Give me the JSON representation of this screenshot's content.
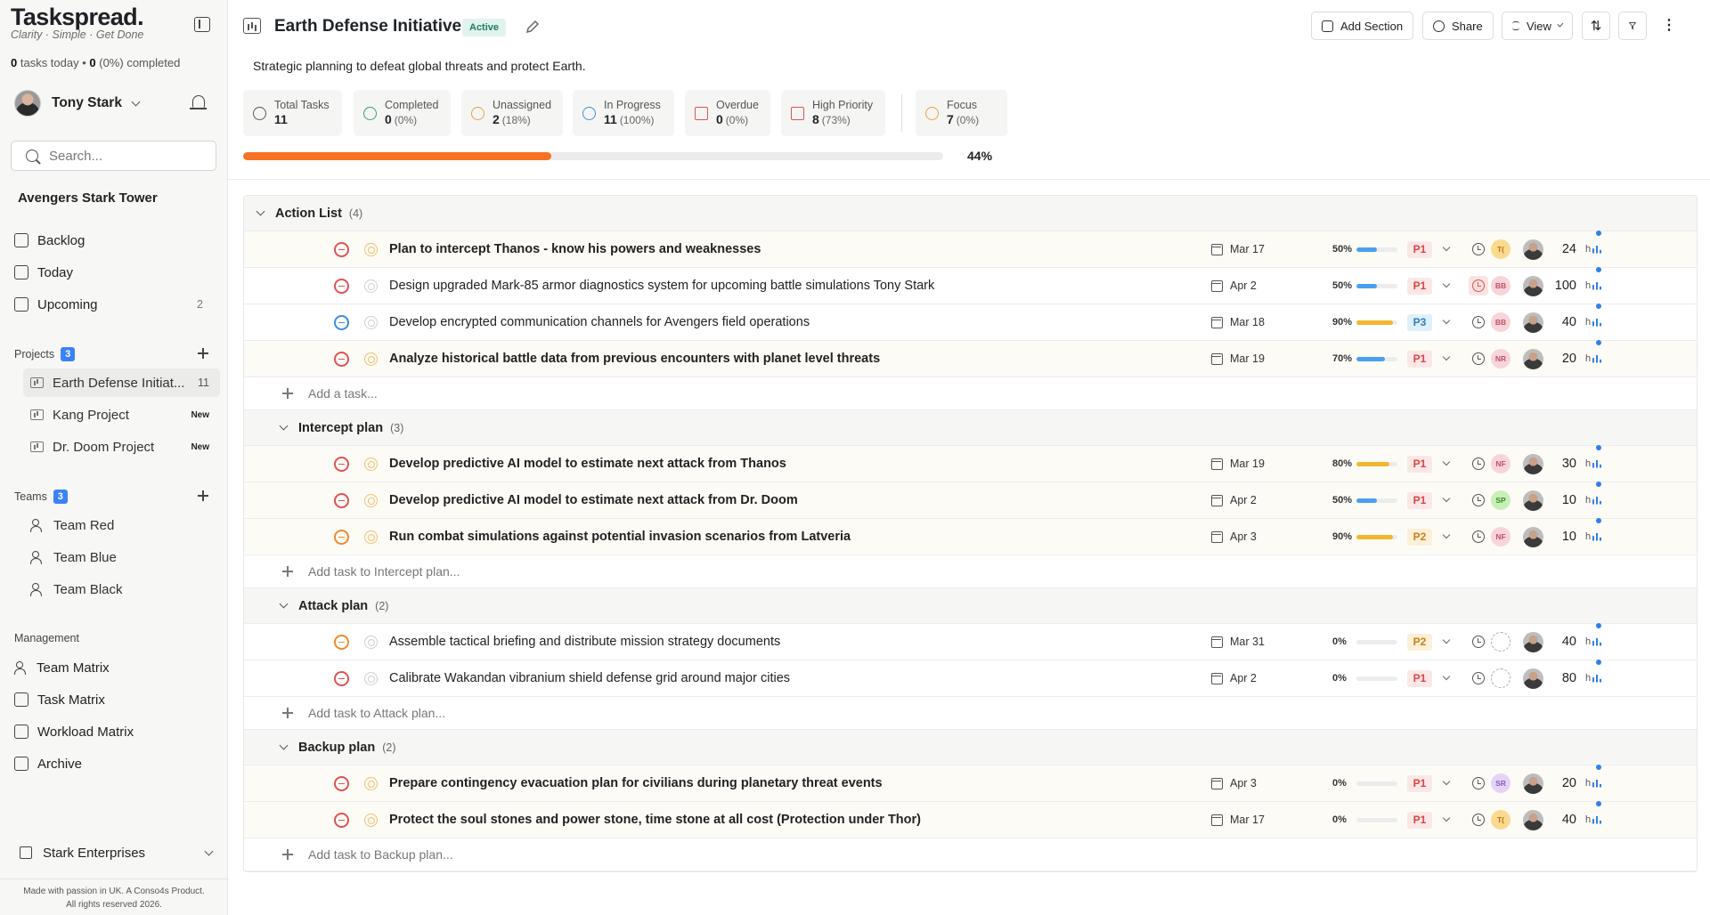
{
  "brand": {
    "name": "Taskspread.",
    "tagline": "Clarity · Simple · Get Done"
  },
  "today": {
    "count": "0",
    "text1": " tasks today • ",
    "done": "0",
    "pct": "(0%)",
    "text2": " completed"
  },
  "user": {
    "name": "Tony Stark"
  },
  "search": {
    "placeholder": "Search..."
  },
  "workspace": "Avengers Stark Tower",
  "nav": [
    {
      "label": "Backlog",
      "icon": "backlog-icon",
      "count": ""
    },
    {
      "label": "Today",
      "icon": "calendar-icon",
      "count": ""
    },
    {
      "label": "Upcoming",
      "icon": "calendar-clock-icon",
      "count": "2"
    }
  ],
  "projects": {
    "label": "Projects",
    "count": "3",
    "items": [
      {
        "label": "Earth Defense Initiat...",
        "badge": "11",
        "active": true
      },
      {
        "label": "Kang Project",
        "badge": "New",
        "active": false
      },
      {
        "label": "Dr. Doom Project",
        "badge": "New",
        "active": false
      }
    ]
  },
  "teams": {
    "label": "Teams",
    "count": "3",
    "items": [
      "Team Red",
      "Team Blue",
      "Team Black"
    ]
  },
  "management": {
    "label": "Management",
    "items": [
      "Team Matrix",
      "Task Matrix",
      "Workload Matrix",
      "Archive"
    ]
  },
  "org": "Stark Enterprises",
  "footer": {
    "line1": "Made with passion in UK. A Conso4s Product.",
    "line2": "All rights reserved 2026."
  },
  "header": {
    "title": "Earth Defense Initiative",
    "status": "Active",
    "description": "Strategic planning to defeat global threats and protect Earth.",
    "buttons": {
      "add_section": "Add Section",
      "share": "Share",
      "view": "View"
    }
  },
  "stats": [
    {
      "label": "Total Tasks",
      "value": "11",
      "pct": "",
      "icon": "circle-icon",
      "color": "#555"
    },
    {
      "label": "Completed",
      "value": "0",
      "pct": "(0%)",
      "icon": "check-circle-icon",
      "color": "#2fa36b"
    },
    {
      "label": "Unassigned",
      "value": "2",
      "pct": "(18%)",
      "icon": "users-icon",
      "color": "#e8a33c"
    },
    {
      "label": "In Progress",
      "value": "11",
      "pct": "(100%)",
      "icon": "clock-icon",
      "color": "#3b8ee6"
    },
    {
      "label": "Overdue",
      "value": "0",
      "pct": "(0%)",
      "icon": "alert-triangle-icon",
      "color": "#e05252"
    },
    {
      "label": "High Priority",
      "value": "8",
      "pct": "(73%)",
      "icon": "flag-icon",
      "color": "#e05252"
    },
    {
      "label": "Focus",
      "value": "7",
      "pct": "(0%)",
      "icon": "target-icon",
      "color": "#e8a33c"
    }
  ],
  "progress": {
    "value": 0.44,
    "label": "44%"
  },
  "sections": [
    {
      "name": "Action List",
      "count": "(4)",
      "indent": false,
      "add": "Add a task...",
      "tasks": [
        {
          "title": "Plan to intercept Thanos - know his powers and weaknesses",
          "bold": true,
          "status": "red",
          "focus": "on",
          "date": "Mar 17",
          "pct": "50%",
          "progress": 0.5,
          "barColor": "#4a9ff0",
          "prio": "P1",
          "alarmRed": false,
          "assignee": "T(",
          "assigneeBg": "#fbd98f",
          "assigneeFg": "#b4730e",
          "est": "24",
          "hl": true
        },
        {
          "title": "Design upgraded Mark-85 armor diagnostics system for upcoming battle simulations Tony Stark",
          "bold": false,
          "status": "red",
          "focus": "gray",
          "date": "Apr 2",
          "pct": "50%",
          "progress": 0.5,
          "barColor": "#4a9ff0",
          "prio": "P1",
          "alarmRed": true,
          "assignee": "BB",
          "assigneeBg": "#f8d4d8",
          "assigneeFg": "#c0506a",
          "est": "100",
          "hl": false
        },
        {
          "title": "Develop encrypted communication channels for Avengers field operations",
          "bold": false,
          "status": "blue",
          "focus": "gray",
          "date": "Mar 18",
          "pct": "90%",
          "progress": 0.9,
          "barColor": "#f2b630",
          "prio": "P3",
          "alarmRed": false,
          "assignee": "BB",
          "assigneeBg": "#f8d4d8",
          "assigneeFg": "#c0506a",
          "est": "40",
          "hl": false
        },
        {
          "title": "Analyze historical battle data from previous encounters with planet level threats",
          "bold": true,
          "status": "red",
          "focus": "on",
          "date": "Mar 19",
          "pct": "70%",
          "progress": 0.7,
          "barColor": "#4a9ff0",
          "prio": "P1",
          "alarmRed": false,
          "assignee": "NR",
          "assigneeBg": "#f8d4d8",
          "assigneeFg": "#c0506a",
          "est": "20",
          "hl": true
        }
      ]
    },
    {
      "name": "Intercept plan",
      "count": "(3)",
      "indent": true,
      "add": "Add task to Intercept plan...",
      "tasks": [
        {
          "title": "Develop predictive AI model to estimate next attack from Thanos",
          "bold": true,
          "status": "red",
          "focus": "on",
          "date": "Mar 19",
          "pct": "80%",
          "progress": 0.8,
          "barColor": "#f2b630",
          "prio": "P1",
          "alarmRed": false,
          "assignee": "NF",
          "assigneeBg": "#f8d4d8",
          "assigneeFg": "#c0506a",
          "est": "30",
          "hl": true
        },
        {
          "title": "Develop predictive AI model to estimate next attack from Dr. Doom",
          "bold": true,
          "status": "red",
          "focus": "on",
          "date": "Apr 2",
          "pct": "50%",
          "progress": 0.5,
          "barColor": "#4a9ff0",
          "prio": "P1",
          "alarmRed": false,
          "assignee": "SP",
          "assigneeBg": "#c9efb9",
          "assigneeFg": "#3c8a25",
          "est": "10",
          "hl": true
        },
        {
          "title": "Run combat simulations against potential invasion scenarios from Latveria",
          "bold": true,
          "status": "orange",
          "focus": "on",
          "date": "Apr 3",
          "pct": "90%",
          "progress": 0.9,
          "barColor": "#f2b630",
          "prio": "P2",
          "alarmRed": false,
          "assignee": "NF",
          "assigneeBg": "#f8d4d8",
          "assigneeFg": "#c0506a",
          "est": "10",
          "hl": true
        }
      ]
    },
    {
      "name": "Attack plan",
      "count": "(2)",
      "indent": true,
      "add": "Add task to Attack plan...",
      "tasks": [
        {
          "title": "Assemble tactical briefing and distribute mission strategy documents",
          "bold": false,
          "status": "orange",
          "focus": "gray",
          "date": "Mar 31",
          "pct": "0%",
          "progress": 0,
          "barColor": "#4a9ff0",
          "prio": "P2",
          "alarmRed": false,
          "assignee": "",
          "assigneeBg": "",
          "assigneeFg": "",
          "est": "40",
          "hl": false
        },
        {
          "title": "Calibrate Wakandan vibranium shield defense grid around major cities",
          "bold": false,
          "status": "red",
          "focus": "gray",
          "date": "Apr 2",
          "pct": "0%",
          "progress": 0,
          "barColor": "#4a9ff0",
          "prio": "P1",
          "alarmRed": false,
          "assignee": "",
          "assigneeBg": "",
          "assigneeFg": "",
          "est": "80",
          "hl": false
        }
      ]
    },
    {
      "name": "Backup plan",
      "count": "(2)",
      "indent": true,
      "add": "Add task to Backup plan...",
      "tasks": [
        {
          "title": "Prepare contingency evacuation plan for civilians during planetary threat events",
          "bold": true,
          "status": "red",
          "focus": "on",
          "date": "Apr 3",
          "pct": "0%",
          "progress": 0,
          "barColor": "#4a9ff0",
          "prio": "P1",
          "alarmRed": false,
          "assignee": "SR",
          "assigneeBg": "#e4d4f5",
          "assigneeFg": "#8a5cc0",
          "est": "20",
          "hl": true
        },
        {
          "title": "Protect the soul stones and power stone, time stone at all cost (Protection under Thor)",
          "bold": true,
          "status": "red",
          "focus": "on",
          "date": "Mar 17",
          "pct": "0%",
          "progress": 0,
          "barColor": "#4a9ff0",
          "prio": "P1",
          "alarmRed": false,
          "assignee": "T(",
          "assigneeBg": "#fbd98f",
          "assigneeFg": "#b4730e",
          "est": "40",
          "hl": true
        }
      ]
    }
  ],
  "est_unit": "h"
}
